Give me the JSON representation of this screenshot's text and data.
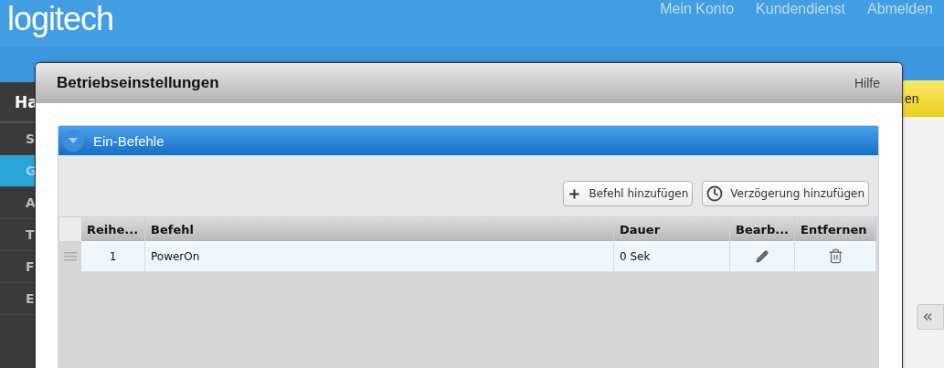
{
  "site_header": {
    "logo": "logitech",
    "nav_links": [
      "Mein Konto",
      "Kundendienst",
      "Abmelden"
    ]
  },
  "sidebar": {
    "heading": "Ha",
    "items": [
      {
        "label": "S",
        "selected": false
      },
      {
        "label": "G",
        "selected": true
      },
      {
        "label": "A",
        "selected": false
      },
      {
        "label": "T",
        "selected": false
      },
      {
        "label": "F",
        "selected": false
      },
      {
        "label": "E",
        "selected": false
      }
    ]
  },
  "right_tab": {
    "label": "en"
  },
  "dialog": {
    "title": "Betriebseinstellungen",
    "help_link": "Hilfe",
    "section": {
      "title": "Ein-Befehle",
      "expanded": true,
      "buttons": [
        {
          "kind": "add",
          "label": "Befehl hinzufügen"
        },
        {
          "kind": "delay",
          "label": "Verzögerung hinzufügen"
        }
      ],
      "table": {
        "columns": [
          "Reihe...",
          "Befehl",
          "Dauer",
          "Bearb...",
          "Entfernen"
        ],
        "rows": [
          {
            "order": "1",
            "command": "PowerOn",
            "duration": "0 Sek"
          }
        ]
      }
    }
  }
}
